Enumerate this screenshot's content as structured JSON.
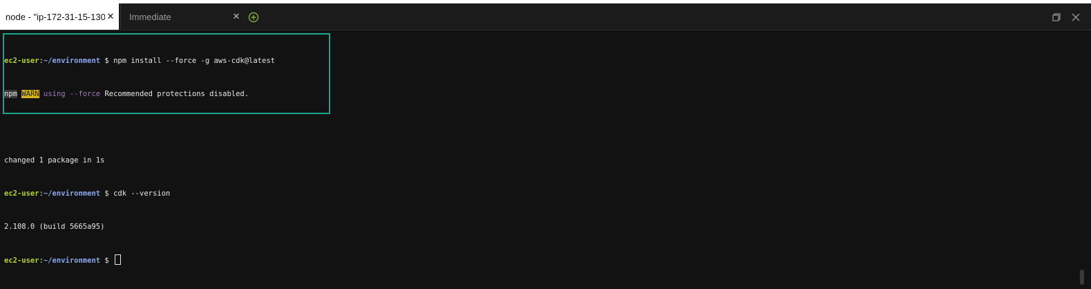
{
  "tabs": [
    {
      "label": "node - \"ip-172-31-15-130.:",
      "active": true
    },
    {
      "label": "Immediate",
      "active": false
    }
  ],
  "terminal": {
    "prompt_user": "ec2-user",
    "prompt_colon": ":",
    "prompt_path": "~/environment",
    "prompt_symbol": " $ ",
    "cmd1": "npm install --force -g aws-cdk@latest",
    "warn_npm": "npm",
    "warn_tag": "WARN",
    "warn_using": "using --force",
    "warn_msg": "Recommended protections disabled.",
    "changed": "changed 1 package in 1s",
    "cmd2": "cdk --version",
    "version_output": "2.108.0 (build 5665a95)"
  },
  "icons": {
    "close": "close-icon",
    "add": "add-tab-icon",
    "restore": "restore-window-icon",
    "close_panel": "close-panel-icon"
  },
  "colors": {
    "highlight_border": "#1aa58c",
    "prompt_user": "#b5d33a",
    "prompt_path": "#8aa8e8",
    "warn_bg": "#d6b520"
  }
}
